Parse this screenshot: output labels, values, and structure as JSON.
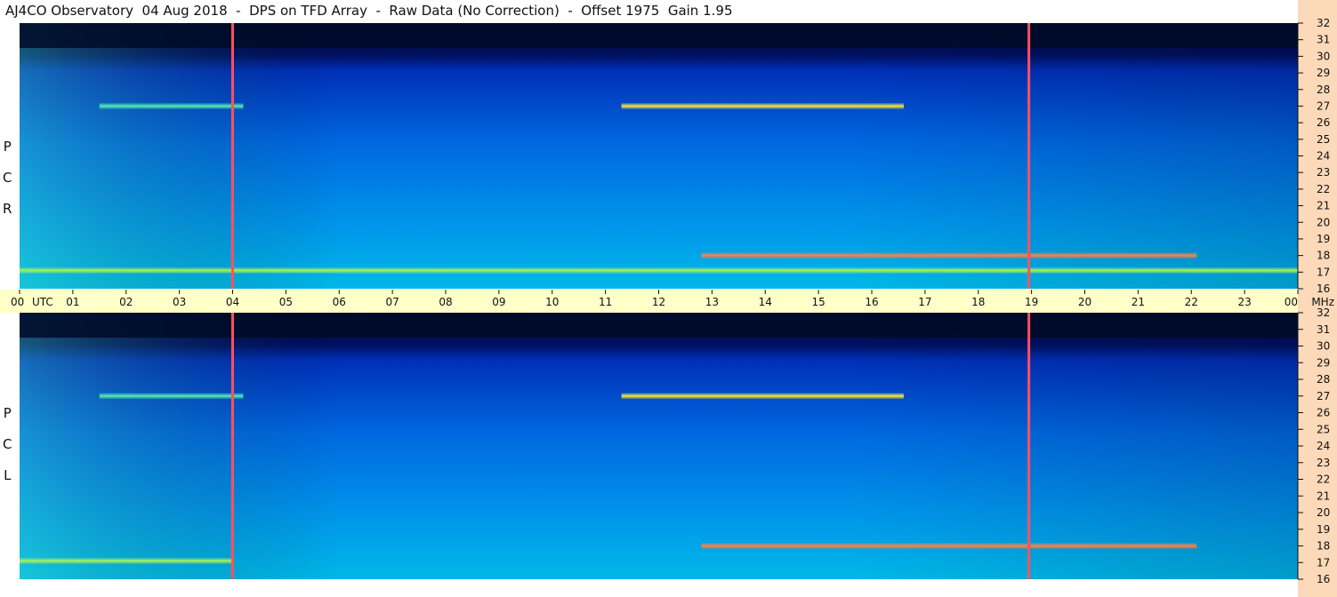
{
  "title": "AJ4CO Observatory  04 Aug 2018  -  DPS on TFD Array  -  Raw Data (No Correction)  -  Offset 1975  Gain 1.95",
  "panels": {
    "top_label": [
      "R",
      "C",
      "P"
    ],
    "bottom_label": [
      "L",
      "C",
      "P"
    ]
  },
  "colors": {
    "time_axis_bg": "#ffffc8",
    "right_axis_bg": "#fcd9b8",
    "marker_line": "#ff5060"
  },
  "chart_data": {
    "type": "heatmap",
    "x_unit": "UTC",
    "y_unit": "MHz",
    "x_ticks": [
      "00",
      "01",
      "02",
      "03",
      "04",
      "05",
      "06",
      "07",
      "08",
      "09",
      "10",
      "11",
      "12",
      "13",
      "14",
      "15",
      "16",
      "17",
      "18",
      "19",
      "20",
      "21",
      "22",
      "23",
      "00"
    ],
    "x_range_hours": [
      0,
      24
    ],
    "y_ticks": [
      32,
      31,
      30,
      29,
      28,
      27,
      26,
      25,
      24,
      23,
      22,
      21,
      20,
      19,
      18,
      17,
      16
    ],
    "y_range_mhz": [
      16,
      32
    ],
    "marker_times_utc_hours": [
      4.0,
      18.95
    ],
    "series": [
      {
        "name": "R C P",
        "features": [
          {
            "kind": "band",
            "freq_mhz": 27.0,
            "t_start": 11.3,
            "t_end": 16.6,
            "intensity": 0.85
          },
          {
            "kind": "band",
            "freq_mhz": 27.0,
            "t_start": 1.5,
            "t_end": 4.2,
            "intensity": 0.55
          },
          {
            "kind": "band",
            "freq_mhz": 18.0,
            "t_start": 12.8,
            "t_end": 22.1,
            "intensity": 0.95
          },
          {
            "kind": "band",
            "freq_mhz": 17.1,
            "t_start": 0.0,
            "t_end": 24.0,
            "intensity": 0.7
          },
          {
            "kind": "dark_top",
            "freq_mhz": 30.5,
            "t_start": 0.0,
            "t_end": 24.0,
            "intensity": 0.0
          }
        ]
      },
      {
        "name": "L C P",
        "features": [
          {
            "kind": "band",
            "freq_mhz": 27.0,
            "t_start": 11.3,
            "t_end": 16.6,
            "intensity": 0.85
          },
          {
            "kind": "band",
            "freq_mhz": 27.0,
            "t_start": 1.5,
            "t_end": 4.2,
            "intensity": 0.55
          },
          {
            "kind": "band",
            "freq_mhz": 18.0,
            "t_start": 12.8,
            "t_end": 22.1,
            "intensity": 0.95
          },
          {
            "kind": "band",
            "freq_mhz": 17.1,
            "t_start": 0.0,
            "t_end": 4.0,
            "intensity": 0.75
          },
          {
            "kind": "dark_top",
            "freq_mhz": 30.5,
            "t_start": 0.0,
            "t_end": 24.0,
            "intensity": 0.0
          }
        ]
      }
    ]
  }
}
